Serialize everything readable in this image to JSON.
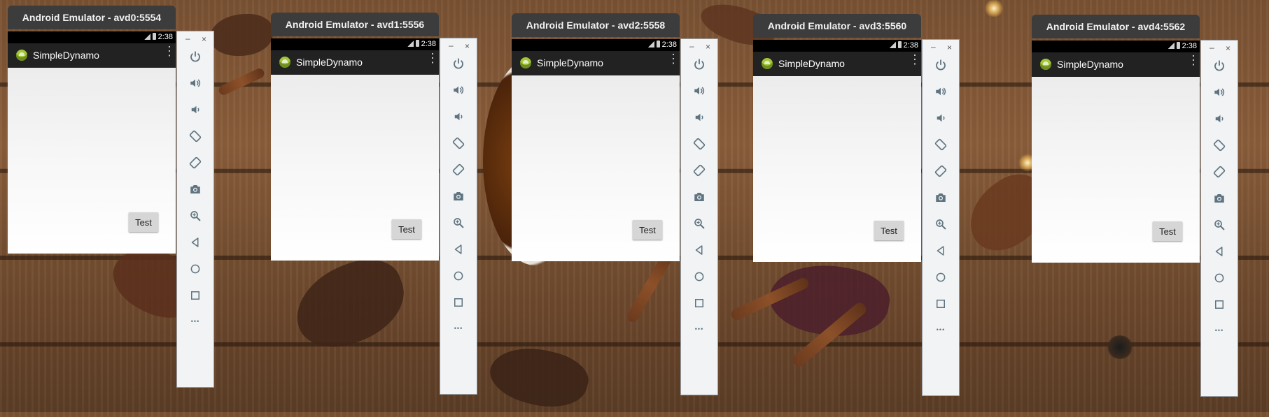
{
  "windows": [
    {
      "title": "Android Emulator - avd0:5554",
      "time": "2:38",
      "app_name": "SimpleDynamo",
      "button": "Test"
    },
    {
      "title": "Android Emulator - avd1:5556",
      "time": "2:38",
      "app_name": "SimpleDynamo",
      "button": "Test"
    },
    {
      "title": "Android Emulator - avd2:5558",
      "time": "2:38",
      "app_name": "SimpleDynamo",
      "button": "Test"
    },
    {
      "title": "Android Emulator - avd3:5560",
      "time": "2:38",
      "app_name": "SimpleDynamo",
      "button": "Test"
    },
    {
      "title": "Android Emulator - avd4:5562",
      "time": "2:38",
      "app_name": "SimpleDynamo",
      "button": "Test"
    }
  ],
  "toolbar": {
    "minimize_glyph": "–",
    "close_glyph": "×",
    "more_glyph": "•••",
    "icons": [
      "power-icon",
      "volume-up-icon",
      "volume-down-icon",
      "rotate-left-icon",
      "rotate-right-icon",
      "camera-icon",
      "zoom-icon",
      "back-icon",
      "home-icon",
      "overview-icon",
      "more-icon"
    ]
  },
  "colors": {
    "titlebar": "#3c3c3c",
    "appbar": "#222222",
    "statusbar": "#000000",
    "toolbar_bg": "#f1f3f4",
    "toolbar_icon": "#5f7480",
    "android_green": "#a4c639",
    "button_bg": "#d6d6d6"
  }
}
